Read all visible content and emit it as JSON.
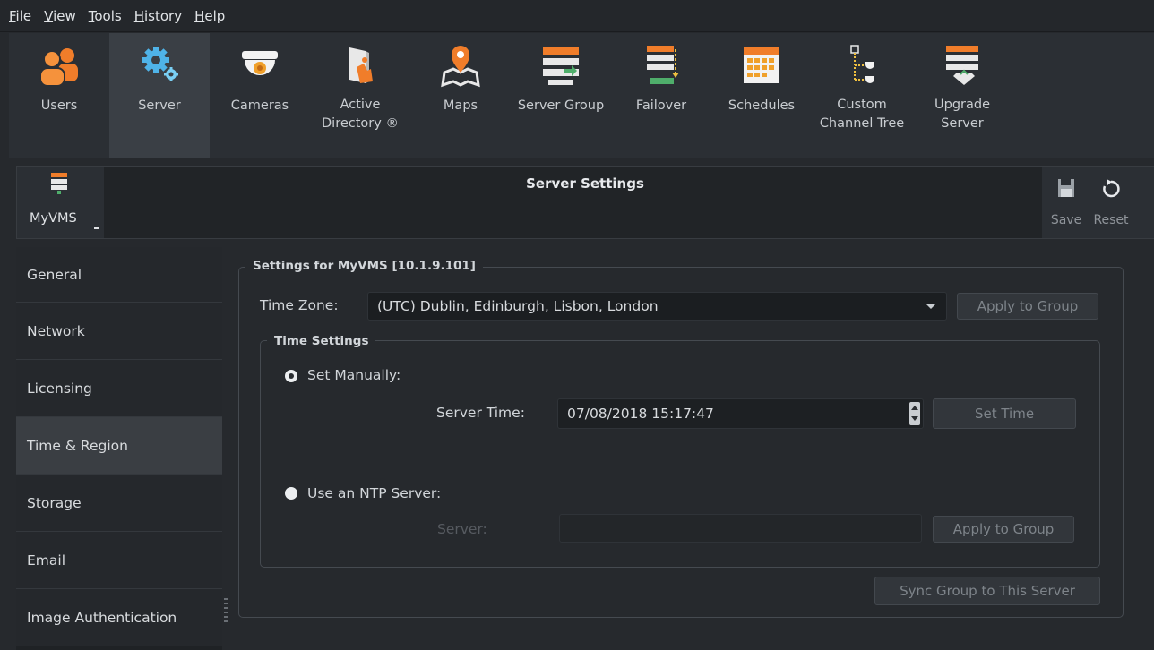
{
  "menu": {
    "items": [
      {
        "first": "F",
        "rest": "ile"
      },
      {
        "first": "V",
        "rest": "iew"
      },
      {
        "first": "T",
        "rest": "ools"
      },
      {
        "first": "H",
        "rest": "istory"
      },
      {
        "first": "H",
        "rest": "elp"
      }
    ]
  },
  "toolbar": {
    "items": [
      {
        "label": "Users",
        "icon": "users-icon"
      },
      {
        "label": "Server",
        "icon": "server-gears-icon",
        "active": true
      },
      {
        "label": "Cameras",
        "icon": "dome-camera-icon"
      },
      {
        "label": "Active\nDirectory ®",
        "icon": "active-directory-icon"
      },
      {
        "label": "Maps",
        "icon": "map-pin-icon"
      },
      {
        "label": "Server Group",
        "icon": "server-group-icon"
      },
      {
        "label": "Failover",
        "icon": "failover-icon"
      },
      {
        "label": "Schedules",
        "icon": "calendar-icon"
      },
      {
        "label": "Custom\nChannel Tree",
        "icon": "channel-tree-icon"
      },
      {
        "label": "Upgrade\nServer",
        "icon": "upgrade-server-icon"
      }
    ]
  },
  "header": {
    "server_name": "MyVMS",
    "title": "Server Settings",
    "save_label": "Save",
    "reset_label": "Reset"
  },
  "sidebar": {
    "items": [
      {
        "label": "General"
      },
      {
        "label": "Network"
      },
      {
        "label": "Licensing"
      },
      {
        "label": "Time & Region",
        "active": true
      },
      {
        "label": "Storage"
      },
      {
        "label": "Email"
      },
      {
        "label": "Image Authentication"
      }
    ]
  },
  "settings": {
    "group_title": "Settings for MyVMS [10.1.9.101]",
    "time_zone_label": "Time Zone:",
    "time_zone_value": "(UTC) Dublin, Edinburgh, Lisbon, London",
    "apply_to_group_label": "Apply to Group",
    "time_settings_title": "Time Settings",
    "set_manually_label": "Set Manually:",
    "server_time_label": "Server Time:",
    "server_time_value": "07/08/2018 15:17:47",
    "set_time_label": "Set Time",
    "use_ntp_label": "Use an NTP Server:",
    "ntp_server_label": "Server:",
    "ntp_server_value": "",
    "ntp_apply_label": "Apply to Group",
    "sync_group_label": "Sync Group to This Server"
  },
  "colors": {
    "accent_orange": "#f07d2a",
    "icon_blue": "#4fb3e8",
    "icon_green": "#4fae6b"
  }
}
